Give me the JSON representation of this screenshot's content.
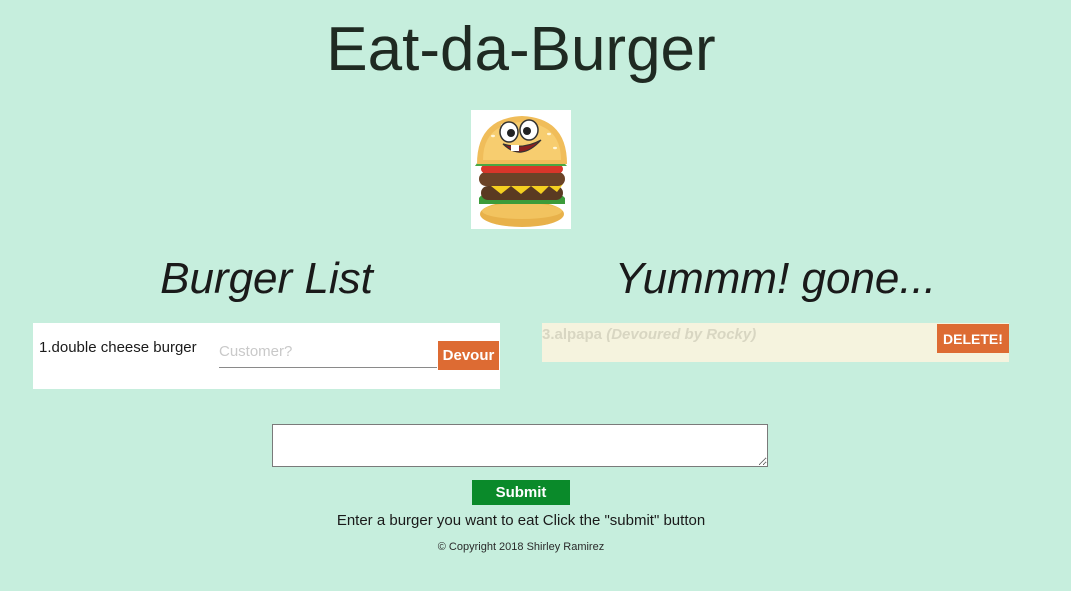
{
  "header": {
    "title": "Eat-da-Burger"
  },
  "logo": {
    "icon": "burger-mascot-icon"
  },
  "burger_list": {
    "title": "Burger List",
    "items": [
      {
        "label": "1.double cheese burger",
        "customer_placeholder": "Customer?",
        "action_label": "Devour"
      }
    ]
  },
  "devoured": {
    "title": "Yummm! gone...",
    "items": [
      {
        "label": "3.alpapa",
        "devoured_by": "(Devoured by Rocky)",
        "action_label": "DELETE!"
      }
    ]
  },
  "form": {
    "submit_label": "Submit",
    "instructions": "Enter a burger you want to eat Click the \"submit\" button"
  },
  "footer": {
    "copyright": "© Copyright 2018 Shirley Ramirez"
  },
  "colors": {
    "background": "#c6eedd",
    "accent_orange": "#dd6b33",
    "submit_green": "#0a8a2a",
    "devoured_card": "#f5f3de"
  }
}
